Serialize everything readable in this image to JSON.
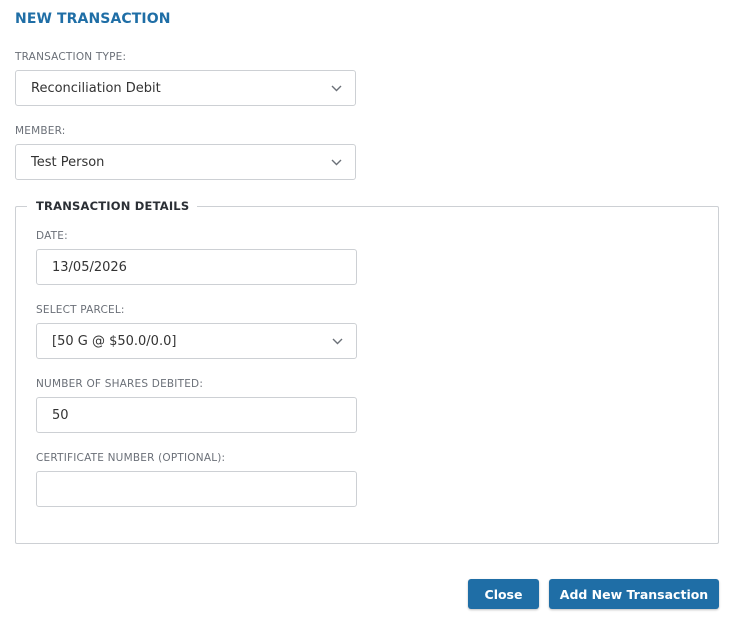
{
  "dialog": {
    "title": "NEW TRANSACTION"
  },
  "transaction_type": {
    "label": "TRANSACTION TYPE:",
    "value": "Reconciliation Debit"
  },
  "member": {
    "label": "MEMBER:",
    "value": "Test Person"
  },
  "details": {
    "legend": "TRANSACTION DETAILS",
    "date": {
      "label": "DATE:",
      "value": "13/05/2026"
    },
    "parcel": {
      "label": "SELECT PARCEL:",
      "value": "[50 G @ $50.0/0.0]"
    },
    "shares": {
      "label": "NUMBER OF SHARES DEBITED:",
      "value": "50"
    },
    "certificate": {
      "label": "CERTIFICATE NUMBER (OPTIONAL):",
      "value": ""
    }
  },
  "buttons": {
    "close_label": "Close",
    "add_label": "Add New Transaction"
  },
  "icons": {
    "dropdown": "chevron-down-icon"
  },
  "colors": {
    "accent": "#1f6ea6",
    "border": "#cdd0d4",
    "label": "#6b7078"
  }
}
